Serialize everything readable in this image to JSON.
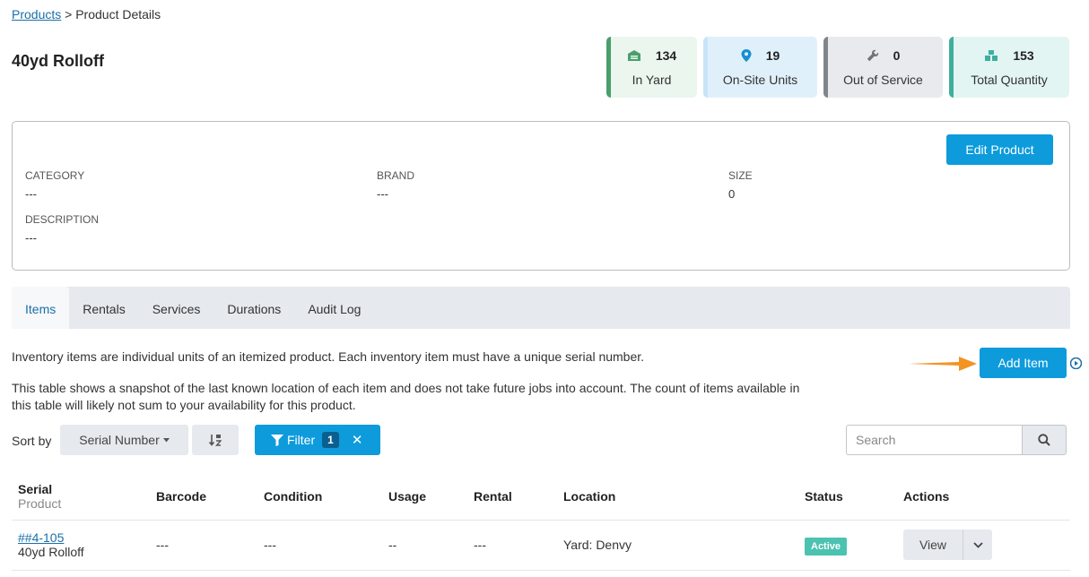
{
  "breadcrumb": {
    "link": "Products",
    "separator": " > ",
    "current": "Product Details"
  },
  "title": "40yd Rolloff",
  "stats": [
    {
      "value": "134",
      "label": "In Yard",
      "color": "#4a9f6b",
      "bg": "#eaf6ee",
      "icon": "warehouse-icon"
    },
    {
      "value": "19",
      "label": "On-Site Units",
      "color": "#c8e4f7",
      "bg": "#e0f0fb",
      "icon": "map-pin-icon"
    },
    {
      "value": "0",
      "label": "Out of Service",
      "color": "#80858c",
      "bg": "#e8eaed",
      "icon": "wrench-icon"
    },
    {
      "value": "153",
      "label": "Total Quantity",
      "color": "#3fae9f",
      "bg": "#e2f5f2",
      "icon": "boxes-icon"
    }
  ],
  "details": {
    "edit_label": "Edit Product",
    "category_label": "CATEGORY",
    "category_value": "---",
    "brand_label": "BRAND",
    "brand_value": "---",
    "size_label": "SIZE",
    "size_value": "0",
    "description_label": "DESCRIPTION",
    "description_value": "---"
  },
  "tabs": [
    "Items",
    "Rentals",
    "Services",
    "Durations",
    "Audit Log"
  ],
  "info": {
    "line1": "Inventory items are individual units of an itemized product. Each inventory item must have a unique serial number.",
    "line2": "This table shows a snapshot of the last known location of each item and does not take future jobs into account. The count of items available in this table will likely not sum to your availability for this product."
  },
  "add_item_label": "Add Item",
  "sort": {
    "label": "Sort by",
    "value": "Serial Number"
  },
  "filter": {
    "label": "Filter",
    "count": "1"
  },
  "search": {
    "placeholder": "Search"
  },
  "table": {
    "headers": {
      "serial": "Serial",
      "serial_sub": "Product",
      "barcode": "Barcode",
      "condition": "Condition",
      "usage": "Usage",
      "rental": "Rental",
      "location": "Location",
      "status": "Status",
      "actions": "Actions"
    },
    "rows": [
      {
        "serial": "##4-105",
        "product": "40yd Rolloff",
        "barcode": "---",
        "condition": "---",
        "usage": "--",
        "rental": "---",
        "location": "Yard: Denvy",
        "status": "Active",
        "view": "View"
      }
    ]
  }
}
